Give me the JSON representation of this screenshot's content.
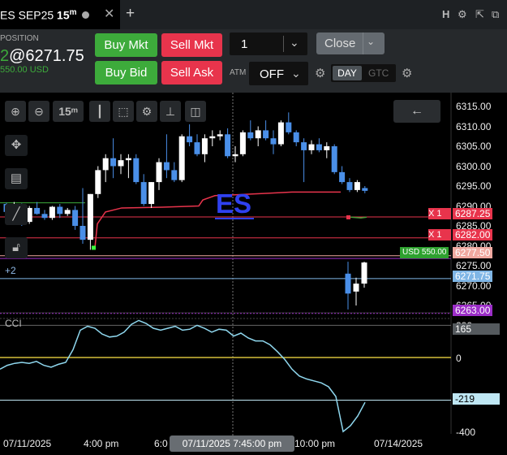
{
  "tab": {
    "title": "ES SEP25 ",
    "interval": "15",
    "interval_unit": "m",
    "close_glyph": "✕",
    "add_glyph": "+"
  },
  "header_right": {
    "h": "H",
    "gear": "⚙",
    "restore": "⇱",
    "popout": "⧉"
  },
  "position": {
    "label": "POSITION",
    "prefix": "2",
    "value": "@6271.75",
    "usd": "550.00 USD"
  },
  "order": {
    "buy_mkt": "Buy Mkt",
    "sell_mkt": "Sell Mkt",
    "buy_bid": "Buy Bid",
    "sell_ask": "Sell Ask",
    "quantity": "1",
    "close": "Close",
    "atm_label": "ATM",
    "atm_value": "OFF",
    "day": "DAY",
    "gtc": "GTC"
  },
  "toolbar": {
    "interval": "15ᵐ"
  },
  "labels": {
    "instrument": "ES",
    "cci": "CCI",
    "position_qty": "+2",
    "usd_tag": "USD 550.00",
    "x1": "X  1",
    "x2": "X  1"
  },
  "price_axis": {
    "ticks": [
      "6315.00",
      "6310.00",
      "6305.00",
      "6300.00",
      "6295.00",
      "6290.00",
      "6285.00",
      "6280.00",
      "6275.00",
      "6270.00",
      "6265.00"
    ],
    "tags": {
      "tp": "6287.25",
      "sl": "6282.00",
      "avg": "6277.50",
      "last": "6271.75",
      "low": "6263.00"
    }
  },
  "cci_axis": {
    "ticks": [
      "200",
      "0",
      "-200",
      "-400"
    ],
    "value": "165",
    "low": "-219"
  },
  "time_axis": {
    "labels": [
      "07/11/2025",
      "4:00 pm",
      "6:0",
      "10:00 pm",
      "07/14/2025"
    ],
    "crosshair": "07/11/2025 7:45:00 pm"
  },
  "colors": {
    "up": "#ffffff",
    "down": "#4a8fe8",
    "ma": "#e8344c",
    "zero": "#d6c03a",
    "cci": "#8fd7ee"
  },
  "chart_data": {
    "type": "candlestick",
    "ylim": [
      6262,
      6317
    ],
    "candles": [
      [
        6290.5,
        6290.8,
        6287.0,
        6288.5
      ],
      [
        6288.5,
        6291.0,
        6287.5,
        6290.0
      ],
      [
        6290.0,
        6290.6,
        6285.0,
        6286.0
      ],
      [
        6286.0,
        6290.0,
        6285.5,
        6289.5
      ],
      [
        6289.5,
        6291.0,
        6287.8,
        6288.0
      ],
      [
        6288.0,
        6289.0,
        6286.5,
        6287.0
      ],
      [
        6287.0,
        6290.0,
        6286.5,
        6289.8
      ],
      [
        6289.8,
        6290.5,
        6287.0,
        6288.0
      ],
      [
        6288.0,
        6289.5,
        6287.5,
        6289.0
      ],
      [
        6289.0,
        6290.0,
        6284.0,
        6285.0
      ],
      [
        6285.0,
        6294.5,
        6280.5,
        6281.5
      ],
      [
        6281.5,
        6293.0,
        6279.0,
        6293.0
      ],
      [
        6293.0,
        6300.0,
        6292.0,
        6299.0
      ],
      [
        6299.0,
        6303.0,
        6296.0,
        6302.0
      ],
      [
        6302.0,
        6307.0,
        6297.0,
        6300.0
      ],
      [
        6300.0,
        6303.0,
        6298.0,
        6301.5
      ],
      [
        6301.5,
        6303.0,
        6297.0,
        6302.0
      ],
      [
        6302.0,
        6303.0,
        6295.5,
        6296.0
      ],
      [
        6296.0,
        6298.0,
        6290.0,
        6290.5
      ],
      [
        6290.5,
        6296.0,
        6289.5,
        6296.0
      ],
      [
        6296.0,
        6302.0,
        6294.0,
        6301.0
      ],
      [
        6301.0,
        6308.0,
        6297.0,
        6299.0
      ],
      [
        6299.0,
        6301.0,
        6296.0,
        6296.5
      ],
      [
        6296.5,
        6308.0,
        6296.0,
        6307.5
      ],
      [
        6307.5,
        6310.5,
        6305.0,
        6306.0
      ],
      [
        6306.0,
        6308.0,
        6302.5,
        6303.0
      ],
      [
        6303.0,
        6308.0,
        6301.0,
        6307.0
      ],
      [
        6307.0,
        6309.0,
        6305.0,
        6307.5
      ],
      [
        6307.5,
        6309.0,
        6306.5,
        6308.0
      ],
      [
        6308.0,
        6309.5,
        6302.0,
        6302.5
      ],
      [
        6302.5,
        6305.0,
        6301.0,
        6303.0
      ],
      [
        6303.0,
        6309.0,
        6302.5,
        6308.5
      ],
      [
        6308.5,
        6311.5,
        6306.5,
        6307.0
      ],
      [
        6307.0,
        6310.0,
        6305.0,
        6309.0
      ],
      [
        6309.0,
        6311.5,
        6306.5,
        6307.0
      ],
      [
        6307.0,
        6309.0,
        6303.0,
        6305.5
      ],
      [
        6305.5,
        6311.5,
        6305.0,
        6311.0
      ],
      [
        6311.0,
        6313.5,
        6308.0,
        6308.5
      ],
      [
        6308.5,
        6309.0,
        6305.0,
        6306.0
      ],
      [
        6306.0,
        6307.0,
        6296.0,
        6304.0
      ],
      [
        6304.0,
        6306.5,
        6303.0,
        6305.5
      ],
      [
        6305.5,
        6307.0,
        6303.5,
        6304.0
      ],
      [
        6304.0,
        6306.0,
        6302.0,
        6305.0
      ],
      [
        6305.0,
        6305.5,
        6298.0,
        6298.5
      ],
      [
        6298.5,
        6300.0,
        6295.5,
        6296.0
      ],
      [
        6296.0,
        6297.0,
        6293.5,
        6294.0
      ],
      [
        6294.0,
        6296.5,
        6293.5,
        6296.0
      ],
      [
        6294.5,
        6295.0,
        6293.2,
        6293.8
      ],
      [
        6273.0,
        6276.0,
        6264.0,
        6268.0
      ],
      [
        6268.5,
        6272.0,
        6265.0,
        6270.5
      ],
      [
        6270.5,
        6276.0,
        6269.5,
        6275.8
      ]
    ],
    "ma": [
      [
        6280.0,
        6285.0,
        6288.0,
        6289.0,
        6289.5,
        6290.0,
        6290.2,
        6290.3,
        6290.4,
        6290.6,
        6291.0,
        6292.0,
        6293.0,
        6293.5,
        6294.0,
        6294.2,
        6294.0,
        6293.8,
        6293.8,
        6293.8
      ]
    ],
    "green_ma": [
      6290.8,
      6290.8
    ],
    "cci": [
      -60,
      -40,
      -30,
      -25,
      -30,
      -20,
      -40,
      -50,
      -35,
      -25,
      40,
      140,
      160,
      150,
      120,
      105,
      110,
      130,
      170,
      190,
      175,
      150,
      140,
      150,
      160,
      140,
      145,
      165,
      150,
      130,
      145,
      140,
      110,
      125,
      100,
      85,
      85,
      65,
      30,
      -10,
      -60,
      -95,
      -110,
      -120,
      -130,
      -150,
      -200,
      -380,
      -350,
      -300,
      -230
    ]
  }
}
